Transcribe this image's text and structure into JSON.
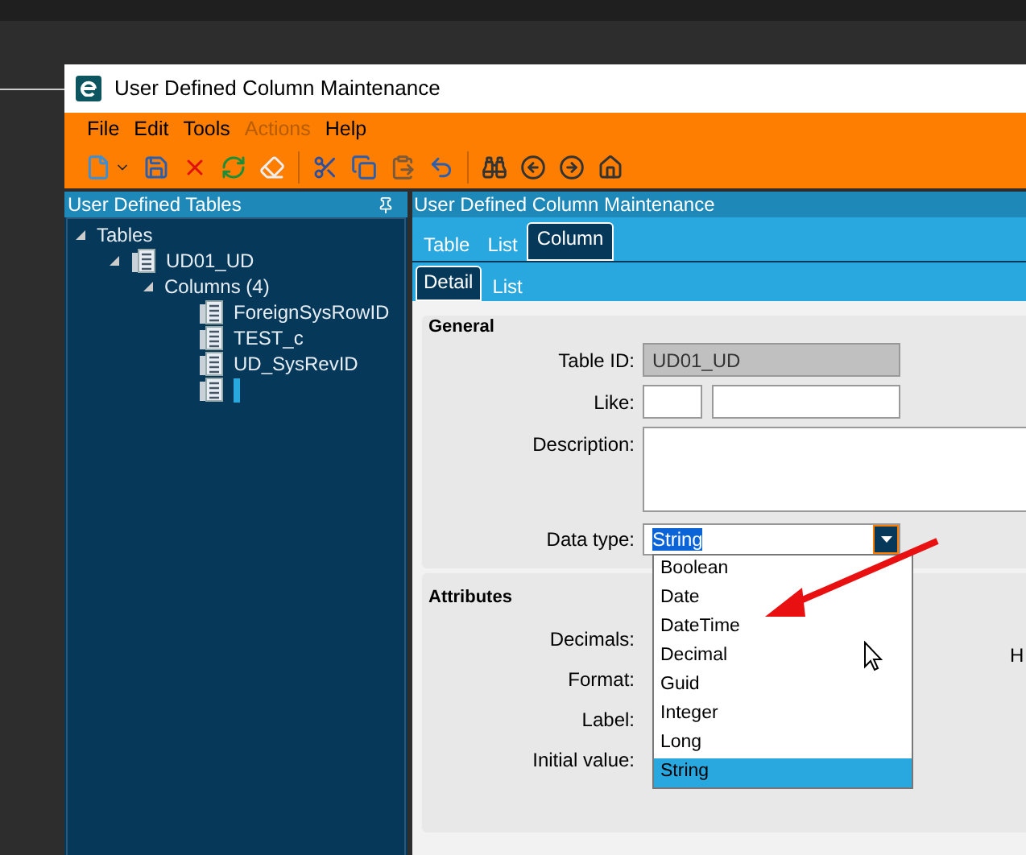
{
  "window": {
    "title": "User Defined Column Maintenance"
  },
  "menu": [
    {
      "label": "File",
      "disabled": false
    },
    {
      "label": "Edit",
      "disabled": false
    },
    {
      "label": "Tools",
      "disabled": false
    },
    {
      "label": "Actions",
      "disabled": true
    },
    {
      "label": "Help",
      "disabled": false
    }
  ],
  "left_panel": {
    "title": "User Defined Tables",
    "tree": [
      {
        "label": "Tables",
        "kind": "folder",
        "expanded": true,
        "children": [
          {
            "label": "UD01_UD",
            "kind": "table",
            "expanded": true,
            "children": [
              {
                "label": "Columns (4)",
                "kind": "folder",
                "expanded": true,
                "children": [
                  {
                    "label": "ForeignSysRowID",
                    "kind": "column",
                    "editing": false
                  },
                  {
                    "label": "TEST_c",
                    "kind": "column",
                    "editing": false
                  },
                  {
                    "label": "UD_SysRevID",
                    "kind": "column",
                    "editing": false
                  },
                  {
                    "kind": "column",
                    "editing": true
                  }
                ]
              }
            ]
          }
        ]
      }
    ]
  },
  "right_panel": {
    "title": "User Defined Column Maintenance",
    "tabs": [
      {
        "label": "Table",
        "selected": false
      },
      {
        "label": "List",
        "selected": false
      },
      {
        "label": "Column",
        "selected": true
      }
    ],
    "subtabs": [
      {
        "label": "Detail",
        "selected": true
      },
      {
        "label": "List",
        "selected": false
      }
    ],
    "general": {
      "title": "General",
      "table_id": {
        "label": "Table ID:",
        "value": "UD01_UD",
        "disabled": true
      },
      "like": {
        "label": "Like:"
      },
      "description": {
        "label": "Description:"
      },
      "data_type": {
        "label": "Data type:",
        "value": "String",
        "options": [
          {
            "label": "Boolean",
            "selected": false
          },
          {
            "label": "Date",
            "selected": false
          },
          {
            "label": "DateTime",
            "selected": false
          },
          {
            "label": "Decimal",
            "selected": false
          },
          {
            "label": "Guid",
            "selected": false
          },
          {
            "label": "Integer",
            "selected": false
          },
          {
            "label": "Long",
            "selected": false
          },
          {
            "label": "String",
            "selected": true
          }
        ]
      }
    },
    "attributes": {
      "title": "Attributes",
      "labels": [
        "Decimals:",
        "Format:",
        "Label:",
        "Initial value:"
      ],
      "column_2_label": "H"
    }
  }
}
